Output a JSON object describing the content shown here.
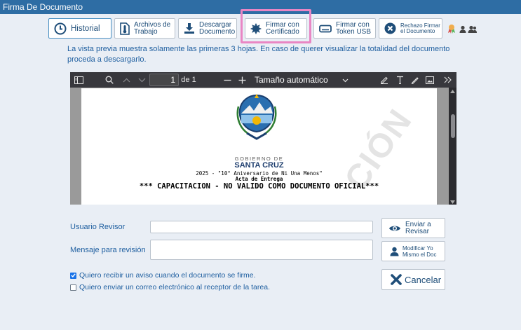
{
  "window": {
    "title": "Firma De Documento"
  },
  "toolbar": {
    "historial": "Historial",
    "archivos": "Archivos de\nTrabajo",
    "descargar": "Descargar\nDocumento",
    "firmar_cert": "Firmar con\nCertificado",
    "firmar_token": "Firmar con\nToken USB",
    "rechazo": "Rechazo Firmar\nel Documento"
  },
  "notice": "La vista previa muestra solamente las primeras 3 hojas. En caso de querer visualizar la totalidad del documento proceda a descargarlo.",
  "viewer": {
    "page_number": "1",
    "page_total": "de 1",
    "zoom": "Tamaño automático",
    "document": {
      "org_line1": "GOBIERNO DE",
      "org_line2": "SANTA CRUZ",
      "year_line": "2025 - \"10° Aniversario de Ni Una Menos\"",
      "doc_type": "Acta de Entrega",
      "warning": "*** CAPACITACION - NO VALIDO COMO DOCUMENTO OFICIAL***",
      "watermark": "CIÓN"
    }
  },
  "form": {
    "usuario_label": "Usuario Revisor",
    "usuario_value": "",
    "mensaje_label": "Mensaje para revisión",
    "mensaje_value": "",
    "enviar": "Enviar a\nRevisar",
    "modificar": "Modificar Yo\nMismo el Doc",
    "cancelar": "Cancelar",
    "aviso_label": "Quiero recibir un aviso cuando el documento se firme.",
    "aviso_checked": true,
    "correo_label": "Quiero enviar un correo electrónico al receptor de la tarea.",
    "correo_checked": false
  }
}
